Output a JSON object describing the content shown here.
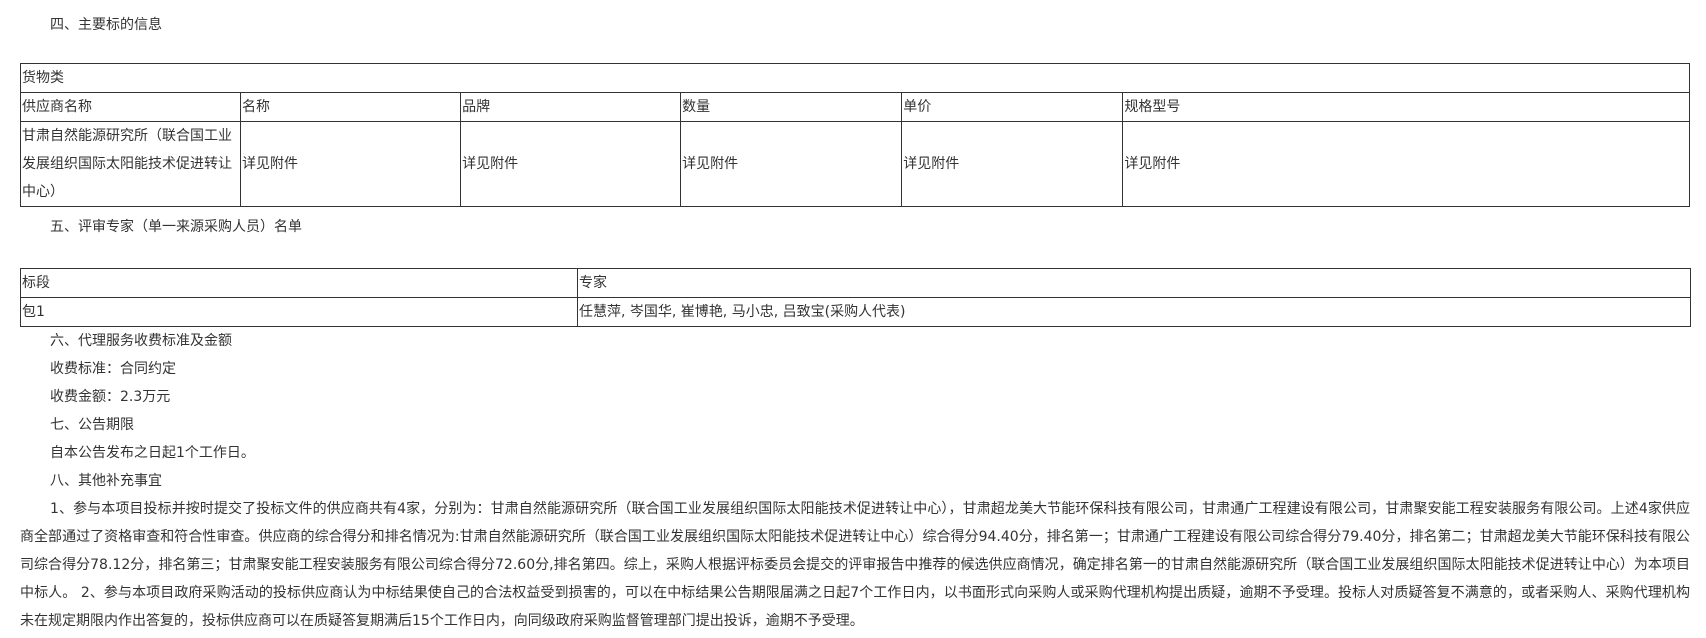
{
  "section4": {
    "title": "四、主要标的信息",
    "table": {
      "category": "货物类",
      "headers": [
        "供应商名称",
        "名称",
        "品牌",
        "数量",
        "单价",
        "规格型号"
      ],
      "row": [
        "甘肃自然能源研究所（联合国工业发展组织国际太阳能技术促进转让中心）",
        "详见附件",
        "详见附件",
        "详见附件",
        "详见附件",
        "详见附件"
      ]
    }
  },
  "section5": {
    "title": "五、评审专家（单一来源采购人员）名单",
    "table": {
      "headers": [
        "标段",
        "专家"
      ],
      "row": [
        "包1",
        "任慧萍, 岑国华, 崔博艳, 马小忠, 吕致宝(采购人代表)"
      ]
    }
  },
  "section6": {
    "title": "六、代理服务收费标准及金额",
    "fee_standard": "收费标准：合同约定",
    "fee_amount": "收费金额：2.3万元"
  },
  "section7": {
    "title": "七、公告期限",
    "text": "自本公告发布之日起1个工作日。"
  },
  "section8": {
    "title": "八、其他补充事宜",
    "text": "1、参与本项目投标并按时提交了投标文件的供应商共有4家，分别为：甘肃自然能源研究所（联合国工业发展组织国际太阳能技术促进转让中心），甘肃超龙美大节能环保科技有限公司，甘肃通广工程建设有限公司，甘肃聚安能工程安装服务有限公司。上述4家供应商全部通过了资格审查和符合性审查。供应商的综合得分和排名情况为:甘肃自然能源研究所（联合国工业发展组织国际太阳能技术促进转让中心）综合得分94.40分，排名第一；甘肃通广工程建设有限公司综合得分79.40分，排名第二；甘肃超龙美大节能环保科技有限公司综合得分78.12分，排名第三；甘肃聚安能工程安装服务有限公司综合得分72.60分,排名第四。综上，采购人根据评标委员会提交的评审报告中推荐的候选供应商情况，确定排名第一的甘肃自然能源研究所（联合国工业发展组织国际太阳能技术促进转让中心）为本项目中标人。 2、参与本项目政府采购活动的投标供应商认为中标结果使自己的合法权益受到损害的，可以在中标结果公告期限届满之日起7个工作日内，以书面形式向采购人或采购代理机构提出质疑，逾期不予受理。投标人对质疑答复不满意的，或者采购人、采购代理机构未在规定期限内作出答复的，投标供应商可以在质疑答复期满后15个工作日内，向同级政府采购监督管理部门提出投诉，逾期不予受理。"
  }
}
